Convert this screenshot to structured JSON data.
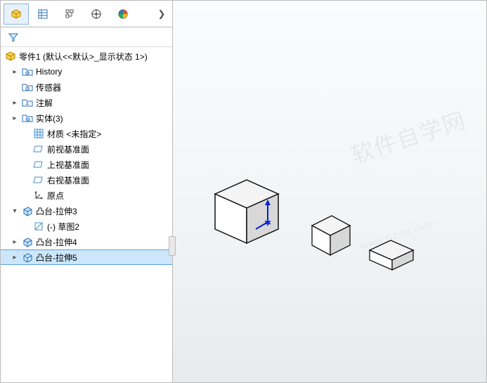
{
  "tree": {
    "root": "零件1  (默认<<默认>_显示状态 1>)",
    "history": "History",
    "sensors": "传感器",
    "annotations": "注解",
    "solids": "实体(3)",
    "material": "材质 <未指定>",
    "front": "前视基准面",
    "top": "上视基准面",
    "right": "右视基准面",
    "origin": "原点",
    "extrude3": "凸台-拉伸3",
    "sketch2": "(-) 草图2",
    "extrude4": "凸台-拉伸4",
    "extrude5": "凸台-拉伸5"
  },
  "watermark": "软件自学网",
  "watermark_url": "www.rjzxw.com"
}
